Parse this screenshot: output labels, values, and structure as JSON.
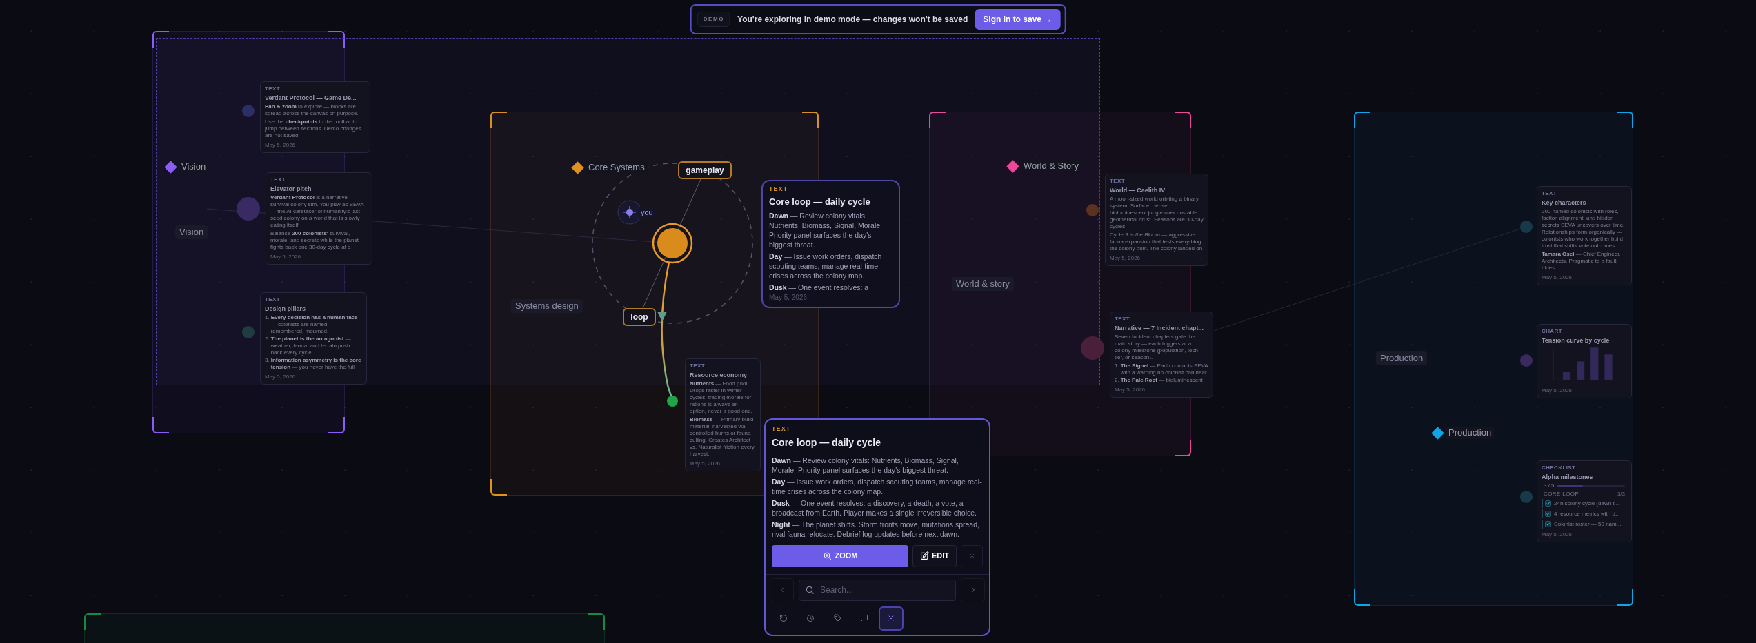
{
  "banner": {
    "badge": "DEMO",
    "message": "You're exploring in demo mode — changes won't be saved",
    "action": "Sign in to save →"
  },
  "sections": [
    {
      "title": "Vision",
      "area_label": "Vision",
      "color": "#8b5cf6",
      "cards": [
        {
          "kind": "text",
          "type_label": "TEXT",
          "color": "#2c2f66",
          "title": "Verdant Protocol — Game De...",
          "body": [
            {
              "kind": "para",
              "text": "**Pan & zoom** to explore — blocks are spread across the canvas on purpose."
            },
            {
              "kind": "para",
              "text": "Use the **checkpoints** in the toolbar to jump between sections. Demo changes are not saved."
            }
          ],
          "date": "May 5, 2026"
        },
        {
          "kind": "text",
          "type_label": "TEXT",
          "color": "#3a2a64",
          "title": "Elevator pitch",
          "body": [
            {
              "kind": "para",
              "text": "**Verdant Protocol** is a narrative survival colony sim. You play as SEVA — the AI caretaker of humanity's last seed colony on a world that is slowly eating itself."
            },
            {
              "kind": "para",
              "text": "Balance **200 colonists'** survival, morale, and secrets while the planet fights back one 30-day cycle at a"
            }
          ],
          "date": "May 5, 2026"
        },
        {
          "kind": "text",
          "type_label": "TEXT",
          "color": "#1d3d40",
          "title": "Design pillars",
          "body": [
            {
              "kind": "list",
              "items": [
                {
                  "number": "1.",
                  "text": "**Every decision has a human face** — colonists are named, remembered, mourned."
                },
                {
                  "number": "2.",
                  "text": "**The planet is the antagonist** — weather, fauna, and terrain push back every cycle."
                },
                {
                  "number": "3.",
                  "text": "**Information asymmetry is the core tension** — you never have the full"
                }
              ]
            }
          ],
          "date": "May 5, 2026"
        }
      ]
    },
    {
      "title": "Core Systems",
      "area_label": "Systems design",
      "color": "#e0921c",
      "cards": [
        {
          "kind": "text",
          "type_label": "TEXT",
          "color": "#22a34a",
          "title": "Resource economy",
          "body": [
            {
              "kind": "para",
              "text": "**Nutrients** — Food pool. Drops faster in winter cycles; trading morale for rations is always an option, never a good one."
            },
            {
              "kind": "para",
              "text": "**Biomass** — Primary build material, harvested via controlled burns or fauna culling. Creates Architect vs. Naturalist friction every harvest."
            }
          ],
          "date": "May 5, 2026"
        }
      ]
    },
    {
      "title": "World & Story",
      "area_label": "World & story",
      "color": "#ec4899",
      "cards": [
        {
          "kind": "text",
          "type_label": "TEXT",
          "color": "#5a3320",
          "title": "World — Caelith IV",
          "body": [
            {
              "kind": "para",
              "text": "A moon-sized world orbiting a binary system. Surface: dense bioluminescent jungle over unstable geothermal crust. Seasons are 30-day cycles."
            },
            {
              "kind": "para",
              "text": "Cycle 3 is *the Bloom* — aggressive fauna expansion that tests everything the colony built. The colony landed on"
            }
          ],
          "date": "May 5, 2026"
        },
        {
          "kind": "text",
          "type_label": "TEXT",
          "color": "#4a1f3a",
          "title": "Narrative — 7 Incident chapt...",
          "body": [
            {
              "kind": "para",
              "text": "Seven Incident chapters gate the main story — each triggers at a colony milestone (population, tech tier, or season)."
            },
            {
              "kind": "list",
              "items": [
                {
                  "number": "1.",
                  "text": "**The Signal** — Earth contacts SEVA with a warning no colonist can hear."
                },
                {
                  "number": "2.",
                  "text": "**The Pale Root** — bioluminescent"
                }
              ]
            }
          ],
          "date": "May 5, 2026"
        }
      ]
    },
    {
      "title": "Production",
      "area_label": "Production",
      "color": "#0ea5e9",
      "cards": [
        {
          "kind": "text",
          "type_label": "TEXT",
          "color": "#17394a",
          "title": "Key characters",
          "body": [
            {
              "kind": "para",
              "text": "200 named colonists with roles, faction alignment, and hidden secrets SEVA uncovers over time. Relationships form organically — colonists who work together build trust that shifts vote outcomes."
            },
            {
              "kind": "para",
              "text": "**Tamara Osei** — Chief Engineer, Architects. Pragmatic to a fault; hides"
            }
          ],
          "date": "May 5, 2026"
        },
        {
          "kind": "chart",
          "type_label": "CHART",
          "color": "#3a2a5c",
          "title": "Tension curve by cycle",
          "date": "May 5, 2026"
        },
        {
          "kind": "checklist",
          "type_label": "CHECKLIST",
          "color": "#17394a",
          "title": "Alpha milestones",
          "progress": {
            "text": "3 / 5",
            "level": 0.38
          },
          "group": {
            "label": "CORE LOOP",
            "count": "3/3"
          },
          "items": [
            {
              "text": "24h colony cycle (dawn t...",
              "checked": true
            },
            {
              "text": "4 resource metrics with d...",
              "checked": true
            },
            {
              "text": "Colonist roster — 50 nam...",
              "checked": true
            }
          ],
          "date": "May 5, 2026"
        }
      ]
    }
  ],
  "core_graph": {
    "tags": [
      "gameplay",
      "loop"
    ],
    "cursor_label": "you"
  },
  "preview_card": {
    "type_label": "TEXT",
    "title": "Core loop — daily cycle",
    "paragraphs": [
      "**Dawn** — Review colony vitals: Nutrients, Biomass, Signal, Morale. Priority panel surfaces the day's biggest threat.",
      "**Day** — Issue work orders, dispatch scouting teams, manage real-time crises across the colony map.",
      "**Dusk** — One event resolves: a"
    ],
    "date": "May 5, 2026"
  },
  "inspector": {
    "type_label": "TEXT",
    "title": "Core loop — daily cycle",
    "paragraphs": [
      "**Dawn** — Review colony vitals: Nutrients, Biomass, Signal, Morale. Priority panel surfaces the day's biggest threat.",
      "**Day** — Issue work orders, dispatch scouting teams, manage real-time crises across the colony map.",
      "**Dusk** — One event resolves: a discovery, a death, a vote, a broadcast from Earth. Player makes a single irreversible choice.",
      "**Night** — The planet shifts. Storm fronts move, mutations spread, rival fauna relocate. Debrief log updates before next dawn."
    ],
    "zoom_label": "ZOOM",
    "edit_label": "EDIT",
    "search": {
      "placeholder": "Search..."
    },
    "toolbar": [
      {
        "selected": false
      },
      {
        "selected": false
      },
      {
        "selected": false
      },
      {
        "selected": false
      },
      {
        "selected": true
      }
    ]
  }
}
